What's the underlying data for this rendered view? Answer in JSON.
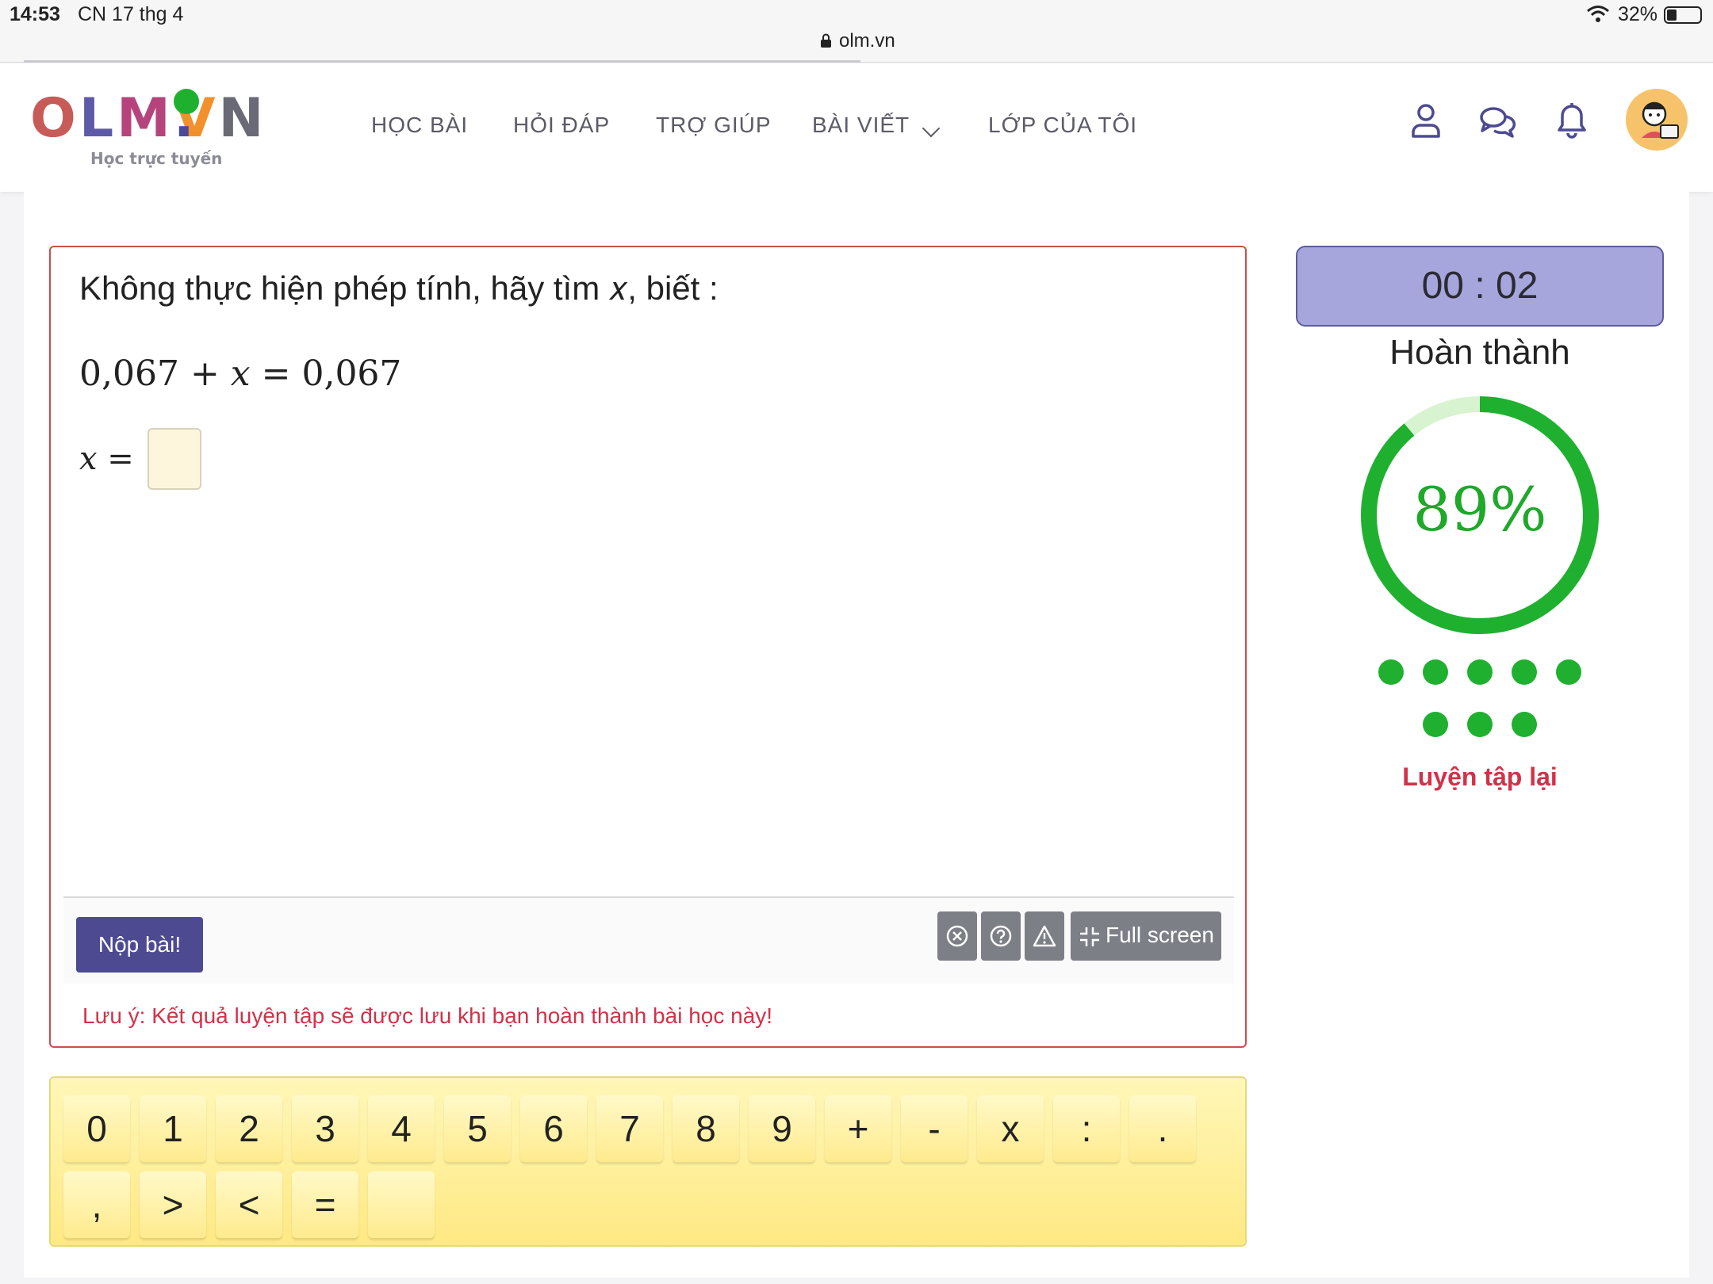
{
  "status_bar": {
    "time": "14:53",
    "date": "CN 17 thg 4",
    "battery": "32%"
  },
  "browser": {
    "url": "olm.vn"
  },
  "header": {
    "logo": {
      "o": "O",
      "l": "L",
      "m": "M",
      "dot": ".",
      "v": "V",
      "n": "N"
    },
    "tagline": "Học trực tuyến",
    "nav": [
      "HỌC BÀI",
      "HỎI ĐÁP",
      "TRỢ GIÚP",
      "BÀI VIẾT",
      "LỚP CỦA TÔI"
    ],
    "icons": [
      "user-icon",
      "chat-icon",
      "bell-icon",
      "avatar"
    ]
  },
  "question": {
    "prompt": "Không thực hiện phép tính, hãy tìm 𝑥, biết :",
    "equation": "0,067 + 𝑥 = 0,067",
    "answer_label": "𝑥 =",
    "answer_value": ""
  },
  "footer": {
    "submit_label": "Nộp bài!",
    "fullscreen_label": "Full screen",
    "note": "Lưu ý: Kết quả luyện tập sẽ được lưu khi bạn hoàn thành bài học này!"
  },
  "keypad": {
    "row1": [
      "0",
      "1",
      "2",
      "3",
      "4",
      "5",
      "6",
      "7",
      "8",
      "9",
      "+",
      "-",
      "x",
      ":",
      "."
    ],
    "row2": [
      ",",
      ">",
      "<",
      "=",
      ""
    ]
  },
  "panel": {
    "timer": "00 : 02",
    "status": "Hoàn thành",
    "progress_text": "89%",
    "progress_value": 0.89,
    "dots_row1": 5,
    "dots_row2": 3,
    "retry_label": "Luyện tập lại"
  },
  "colors": {
    "accent": "#4d4a92",
    "ring": "#1fb02f",
    "ring_track": "#d7f3cf",
    "alert": "#d1324a"
  }
}
